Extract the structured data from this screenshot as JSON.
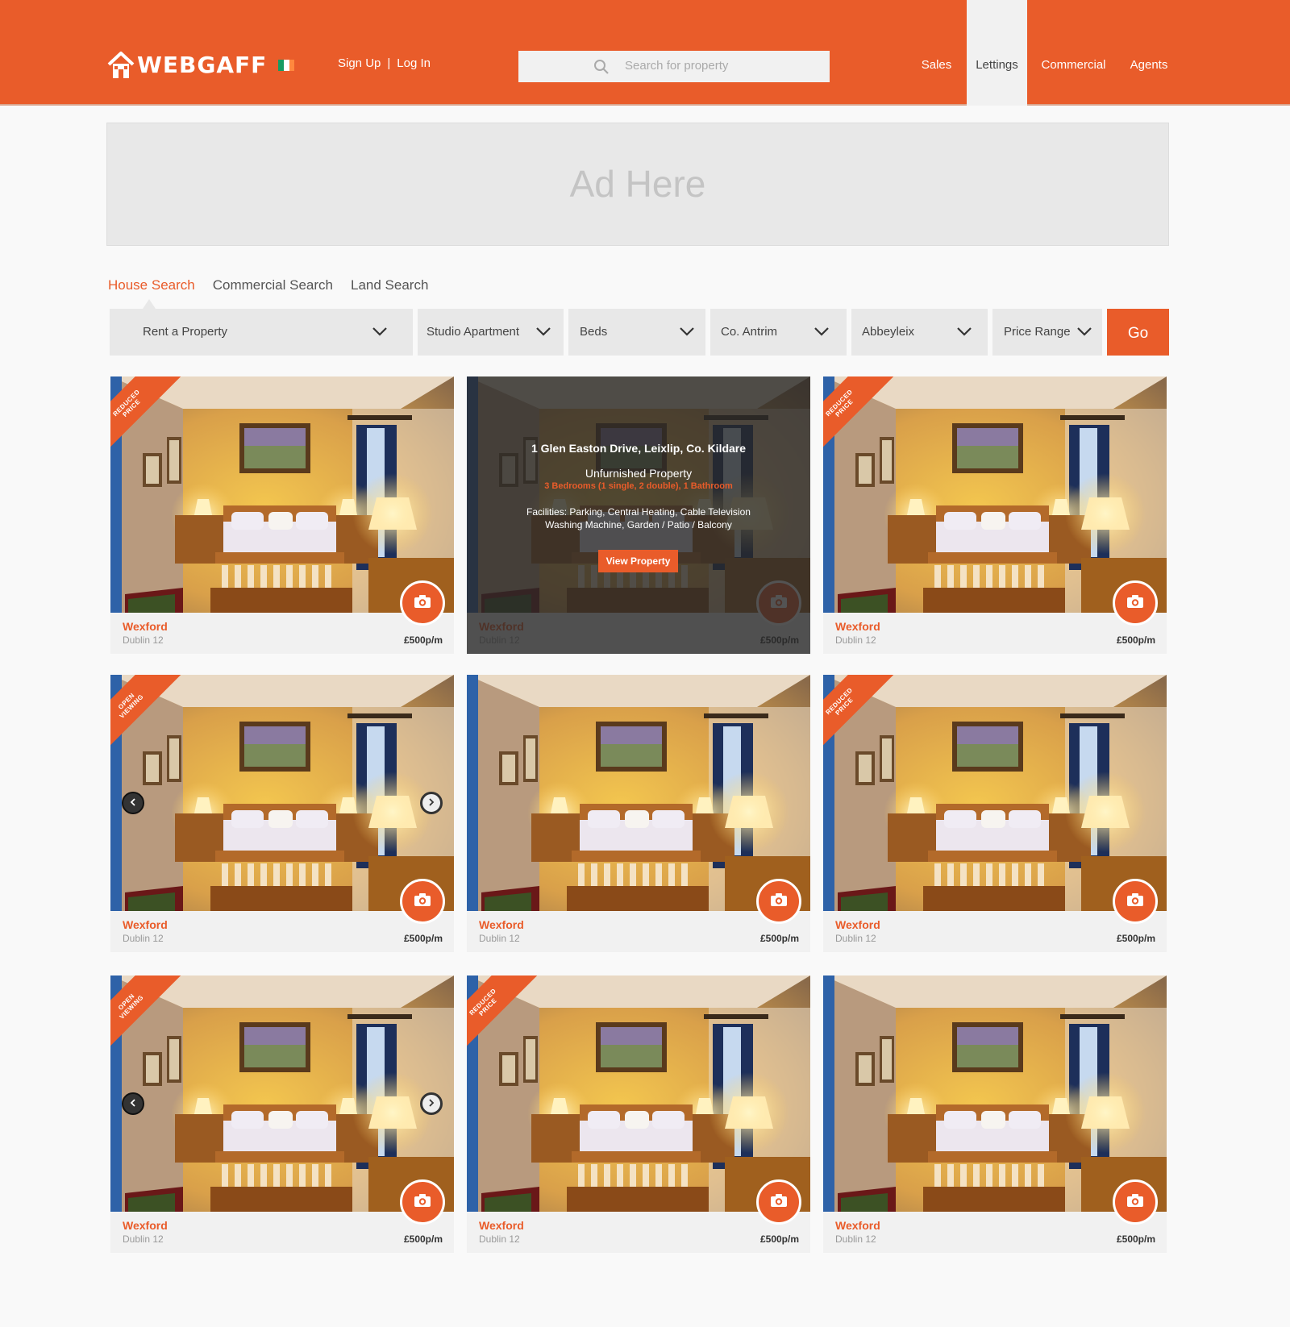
{
  "header": {
    "logo_text": "WEBGAFF",
    "flag_colors": [
      "#169b62",
      "#ffffff",
      "#ff883e"
    ],
    "sign_up": "Sign Up",
    "separator": "|",
    "log_in": "Log In",
    "search_placeholder": "Search for property",
    "nav": [
      {
        "label": "Sales",
        "active": false
      },
      {
        "label": "Lettings",
        "active": true
      },
      {
        "label": "Commercial",
        "active": false
      },
      {
        "label": "Agents",
        "active": false
      }
    ]
  },
  "ad": {
    "text": "Ad Here"
  },
  "search_tabs": [
    {
      "label": "House Search",
      "active": true
    },
    {
      "label": "Commercial Search",
      "active": false
    },
    {
      "label": "Land Search",
      "active": false
    }
  ],
  "filters": {
    "mode": "Rent a Property",
    "property_type": "Studio Apartment",
    "beds": "Beds",
    "county": "Co. Antrim",
    "town": "Abbeyleix",
    "price": "Price Range",
    "go": "Go"
  },
  "colors": {
    "accent": "#e95c2a",
    "header": "#e95c2a",
    "card_bg": "#f1f1f1"
  },
  "listings": [
    {
      "town": "Wexford",
      "area": "Dublin 12",
      "price": "£500p/m",
      "ribbon": "REDUCED PRICE",
      "arrows": false,
      "hover": false
    },
    {
      "town": "Wexford",
      "area": "Dublin 12",
      "price": "£500p/m",
      "ribbon": "",
      "arrows": false,
      "hover": true
    },
    {
      "town": "Wexford",
      "area": "Dublin 12",
      "price": "£500p/m",
      "ribbon": "REDUCED PRICE",
      "arrows": false,
      "hover": false
    },
    {
      "town": "Wexford",
      "area": "Dublin 12",
      "price": "£500p/m",
      "ribbon": "OPEN VIEWING",
      "arrows": true,
      "hover": false
    },
    {
      "town": "Wexford",
      "area": "Dublin 12",
      "price": "£500p/m",
      "ribbon": "",
      "arrows": false,
      "hover": false
    },
    {
      "town": "Wexford",
      "area": "Dublin 12",
      "price": "£500p/m",
      "ribbon": "REDUCED PRICE",
      "arrows": false,
      "hover": false
    },
    {
      "town": "Wexford",
      "area": "Dublin 12",
      "price": "£500p/m",
      "ribbon": "OPEN VIEWING",
      "arrows": true,
      "hover": false
    },
    {
      "town": "Wexford",
      "area": "Dublin 12",
      "price": "£500p/m",
      "ribbon": "REDUCED PRICE",
      "arrows": false,
      "hover": false
    },
    {
      "town": "Wexford",
      "area": "Dublin 12",
      "price": "£500p/m",
      "ribbon": "",
      "arrows": false,
      "hover": false
    }
  ],
  "hover_details": {
    "address": "1 Glen Easton Drive, Leixlip, Co. Kildare",
    "type": "Unfurnished Property",
    "bedrooms": "3 Bedrooms (1 single, 2 double), 1 Bathroom",
    "facilities_line1": "Facilities: Parking, Central Heating, Cable Television",
    "facilities_line2": "Washing Machine, Garden / Patio / Balcony",
    "button": "View Property"
  },
  "icons": {
    "search": "search-icon",
    "chevron": "chevron-down-icon",
    "camera": "camera-icon",
    "prev": "chevron-left-icon",
    "next": "chevron-right-icon"
  }
}
